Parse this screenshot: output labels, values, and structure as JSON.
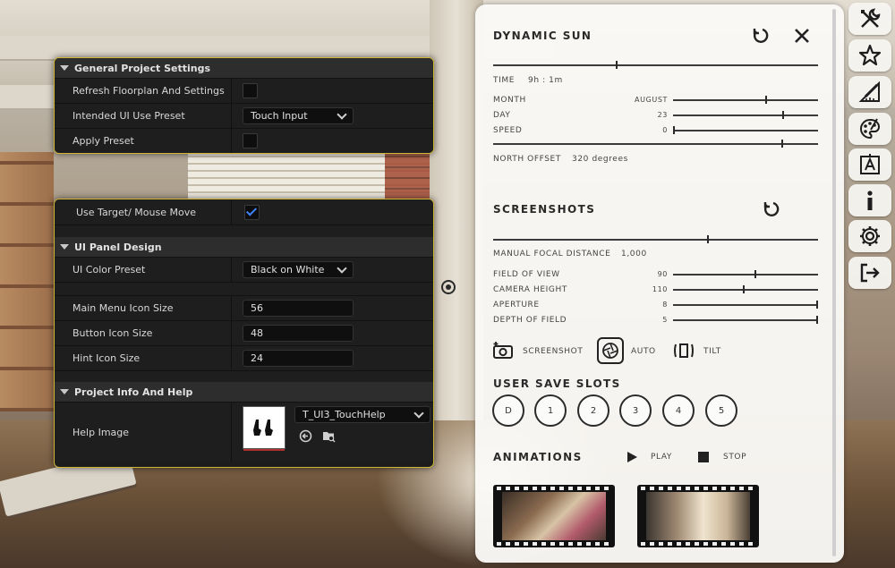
{
  "settings": {
    "general": {
      "title": "General Project Settings",
      "refresh_label": "Refresh Floorplan And Settings",
      "preset_label": "Intended UI Use Preset",
      "preset_value": "Touch Input",
      "apply_label": "Apply Preset"
    },
    "target": {
      "label": "Use Target/ Mouse Move",
      "checked": true
    },
    "ui_panel": {
      "title": "UI Panel Design",
      "color_label": "UI Color Preset",
      "color_value": "Black on White",
      "main_icon_label": "Main Menu Icon Size",
      "main_icon_value": "56",
      "button_icon_label": "Button Icon Size",
      "button_icon_value": "48",
      "hint_icon_label": "Hint Icon Size",
      "hint_icon_value": "24"
    },
    "info": {
      "title": "Project Info And Help",
      "help_label": "Help Image",
      "help_asset": "T_UI3_TouchHelp"
    }
  },
  "sun": {
    "title": "DYNAMIC SUN",
    "time_label": "TIME",
    "time_value": "9h : 1m",
    "time_pos": 0.38,
    "month_label": "MONTH",
    "month_value": "AUGUST",
    "month_pos": 0.64,
    "day_label": "DAY",
    "day_value": "23",
    "day_pos": 0.76,
    "speed_label": "SPEED",
    "speed_value": "0",
    "speed_pos": 0.0,
    "north_label": "NORTH OFFSET",
    "north_value": "320 degrees",
    "north_pos": 0.89
  },
  "screenshots": {
    "title": "SCREENSHOTS",
    "focal_label": "MANUAL FOCAL DISTANCE",
    "focal_value": "1,000",
    "focal_pos": 0.66,
    "fov_label": "FIELD OF VIEW",
    "fov_value": "90",
    "fov_pos": 0.57,
    "height_label": "CAMERA HEIGHT",
    "height_value": "110",
    "height_pos": 0.49,
    "aperture_label": "APERTURE",
    "aperture_value": "8",
    "aperture_pos": 1.0,
    "dof_label": "DEPTH OF FIELD",
    "dof_value": "5",
    "dof_pos": 1.0,
    "screenshot_btn": "SCREENSHOT",
    "auto_btn": "AUTO",
    "tilt_btn": "TILT"
  },
  "slots": {
    "title": "USER SAVE SLOTS",
    "items": [
      "D",
      "1",
      "2",
      "3",
      "4",
      "5"
    ]
  },
  "animations": {
    "title": "ANIMATIONS",
    "play": "PLAY",
    "stop": "STOP"
  },
  "colors": {
    "accent_border": "#cfb636",
    "panel_dark": "#1c1c1c",
    "check_blue": "#3d86ff",
    "white_panel": "#faf9f6"
  }
}
